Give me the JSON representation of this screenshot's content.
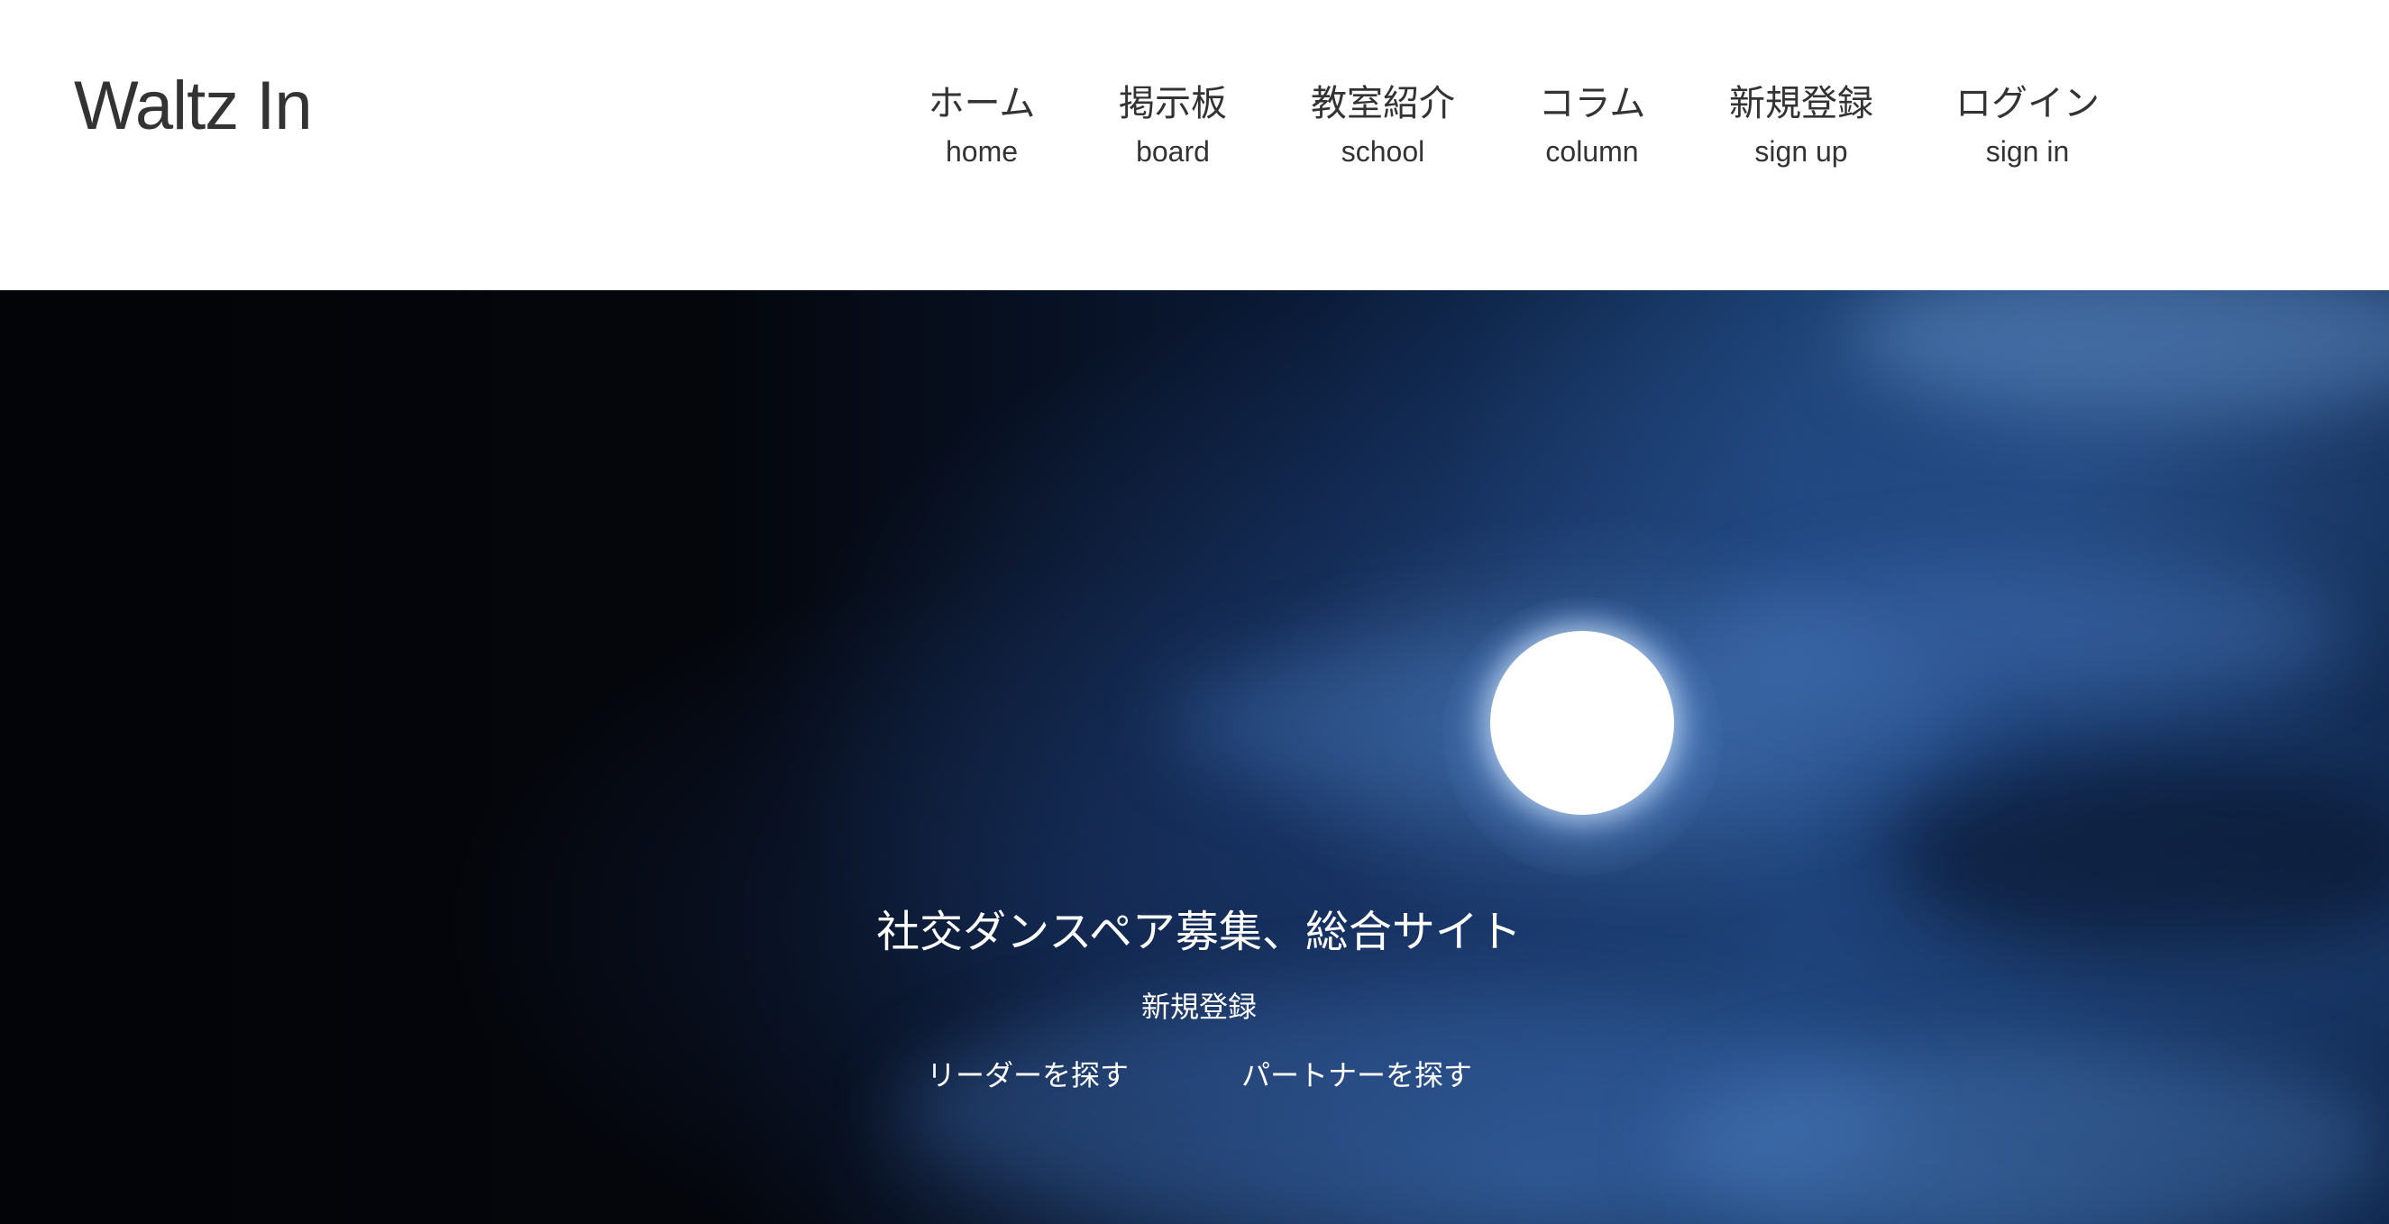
{
  "header": {
    "logo": "Waltz In",
    "nav": [
      {
        "ja": "ホーム",
        "en": "home"
      },
      {
        "ja": "掲示板",
        "en": "board"
      },
      {
        "ja": "教室紹介",
        "en": "school"
      },
      {
        "ja": "コラム",
        "en": "column"
      },
      {
        "ja": "新規登録",
        "en": "sign up"
      },
      {
        "ja": "ログイン",
        "en": "sign in"
      }
    ]
  },
  "hero": {
    "title": "社交ダンスペア募集、総合サイト",
    "signup_link": "新規登録",
    "find_leader_link": "リーダーを探す",
    "find_partner_link": "パートナーを探す"
  },
  "colors": {
    "header_bg": "#ffffff",
    "text_dark": "#333333",
    "hero_text": "#ffffff",
    "night_sky": "#04060c",
    "cloud_blue": "#3a6aa8"
  }
}
